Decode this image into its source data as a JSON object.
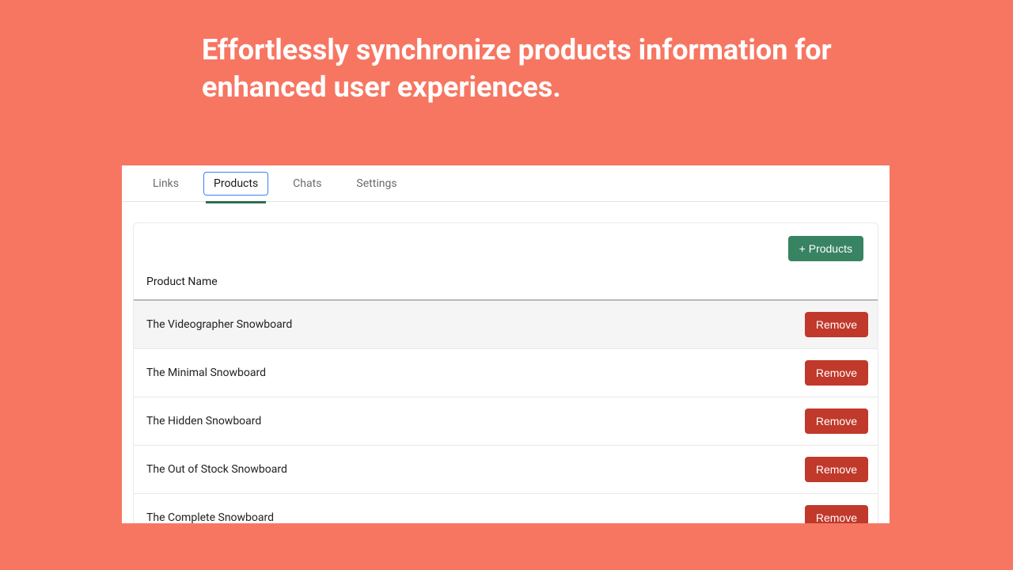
{
  "headline": "Effortlessly synchronize products information for enhanced user experiences.",
  "tabs": [
    {
      "label": "Links",
      "active": false
    },
    {
      "label": "Products",
      "active": true
    },
    {
      "label": "Chats",
      "active": false
    },
    {
      "label": "Settings",
      "active": false
    }
  ],
  "add_button_label": "+ Products",
  "column_header": "Product Name",
  "remove_label": "Remove",
  "products": [
    {
      "name": "The Videographer Snowboard",
      "highlight": true
    },
    {
      "name": "The Minimal Snowboard",
      "highlight": false
    },
    {
      "name": "The Hidden Snowboard",
      "highlight": false
    },
    {
      "name": "The Out of Stock Snowboard",
      "highlight": false
    },
    {
      "name": "The Complete Snowboard",
      "highlight": false
    }
  ]
}
